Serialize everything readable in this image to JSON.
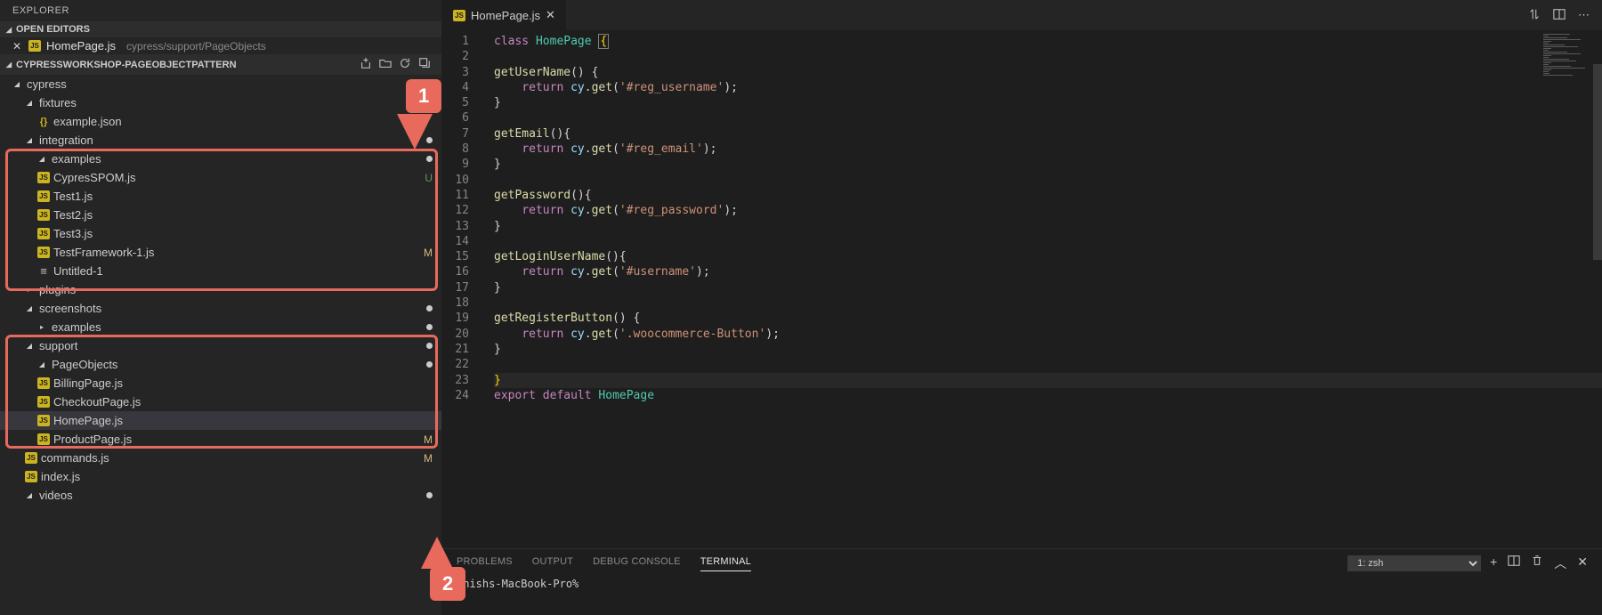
{
  "explorer": {
    "title": "EXPLORER"
  },
  "openEditors": {
    "label": "OPEN EDITORS",
    "items": [
      {
        "name": "HomePage.js",
        "path": "cypress/support/PageObjects"
      }
    ]
  },
  "project": {
    "name": "CYPRESSWORKSHOP-PAGEOBJECTPATTERN"
  },
  "tree": {
    "cypress": "cypress",
    "fixtures": "fixtures",
    "example_json": "example.json",
    "integration": "integration",
    "examples": "examples",
    "cypresspom": "CypresSPOM.js",
    "test1": "Test1.js",
    "test2": "Test2.js",
    "test3": "Test3.js",
    "testframework": "TestFramework-1.js",
    "untitled": "Untitled-1",
    "plugins": "plugins",
    "screenshots": "screenshots",
    "examples2": "examples",
    "support": "support",
    "pageobjects": "PageObjects",
    "billing": "BillingPage.js",
    "checkout": "CheckoutPage.js",
    "homepage": "HomePage.js",
    "product": "ProductPage.js",
    "commands": "commands.js",
    "index": "index.js",
    "videos": "videos"
  },
  "status": {
    "u": "U",
    "m": "M"
  },
  "callouts": {
    "one": "1",
    "two": "2"
  },
  "tab": {
    "name": "HomePage.js"
  },
  "code": {
    "lines": [
      {
        "n": 1,
        "html": "<span class='tok-kw'>class</span> <span class='tok-cls'>HomePage</span> <span class='cursor-box'><span class='tok-brace'>{</span></span>"
      },
      {
        "n": 2,
        "html": ""
      },
      {
        "n": 3,
        "html": "<span class='tok-fn'>getUserName</span><span class='tok-punc'>()</span> <span class='tok-punc'>{</span>"
      },
      {
        "n": 4,
        "html": "    <span class='tok-kw'>return</span> <span class='tok-var'>cy</span><span class='tok-punc'>.</span><span class='tok-fn'>get</span><span class='tok-punc'>(</span><span class='tok-str'>'#reg_username'</span><span class='tok-punc'>);</span>"
      },
      {
        "n": 5,
        "html": "<span class='tok-punc'>}</span>"
      },
      {
        "n": 6,
        "html": ""
      },
      {
        "n": 7,
        "html": "<span class='tok-fn'>getEmail</span><span class='tok-punc'>(){</span>"
      },
      {
        "n": 8,
        "html": "    <span class='tok-kw'>return</span> <span class='tok-var'>cy</span><span class='tok-punc'>.</span><span class='tok-fn'>get</span><span class='tok-punc'>(</span><span class='tok-str'>'#reg_email'</span><span class='tok-punc'>);</span>"
      },
      {
        "n": 9,
        "html": "<span class='tok-punc'>}</span>"
      },
      {
        "n": 10,
        "html": ""
      },
      {
        "n": 11,
        "html": "<span class='tok-fn'>getPassword</span><span class='tok-punc'>(){</span>"
      },
      {
        "n": 12,
        "html": "    <span class='tok-kw'>return</span> <span class='tok-var'>cy</span><span class='tok-punc'>.</span><span class='tok-fn'>get</span><span class='tok-punc'>(</span><span class='tok-str'>'#reg_password'</span><span class='tok-punc'>);</span>"
      },
      {
        "n": 13,
        "html": "<span class='tok-punc'>}</span>"
      },
      {
        "n": 14,
        "html": ""
      },
      {
        "n": 15,
        "html": "<span class='tok-fn'>getLoginUserName</span><span class='tok-punc'>(){</span>"
      },
      {
        "n": 16,
        "html": "    <span class='tok-kw'>return</span> <span class='tok-var'>cy</span><span class='tok-punc'>.</span><span class='tok-fn'>get</span><span class='tok-punc'>(</span><span class='tok-str'>'#username'</span><span class='tok-punc'>);</span>"
      },
      {
        "n": 17,
        "html": "<span class='tok-punc'>}</span>"
      },
      {
        "n": 18,
        "html": ""
      },
      {
        "n": 19,
        "html": "<span class='tok-fn'>getRegisterButton</span><span class='tok-punc'>() {</span>"
      },
      {
        "n": 20,
        "html": "    <span class='tok-kw'>return</span> <span class='tok-var'>cy</span><span class='tok-punc'>.</span><span class='tok-fn'>get</span><span class='tok-punc'>(</span><span class='tok-str'>'.woocommerce-Button'</span><span class='tok-punc'>);</span>"
      },
      {
        "n": 21,
        "html": "<span class='tok-punc'>}</span>"
      },
      {
        "n": 22,
        "html": ""
      },
      {
        "n": 23,
        "html": "<span class='tok-brace'>}</span>",
        "hl": true
      },
      {
        "n": 24,
        "html": "<span class='tok-kw'>export</span> <span class='tok-kw'>default</span> <span class='tok-cls'>HomePage</span>"
      }
    ]
  },
  "panel": {
    "tabs": {
      "problems": "PROBLEMS",
      "output": "OUTPUT",
      "debug": "DEBUG CONSOLE",
      "terminal": "TERMINAL"
    },
    "shell": "1: zsh",
    "prompt": "shishs-MacBook-Pro%"
  }
}
